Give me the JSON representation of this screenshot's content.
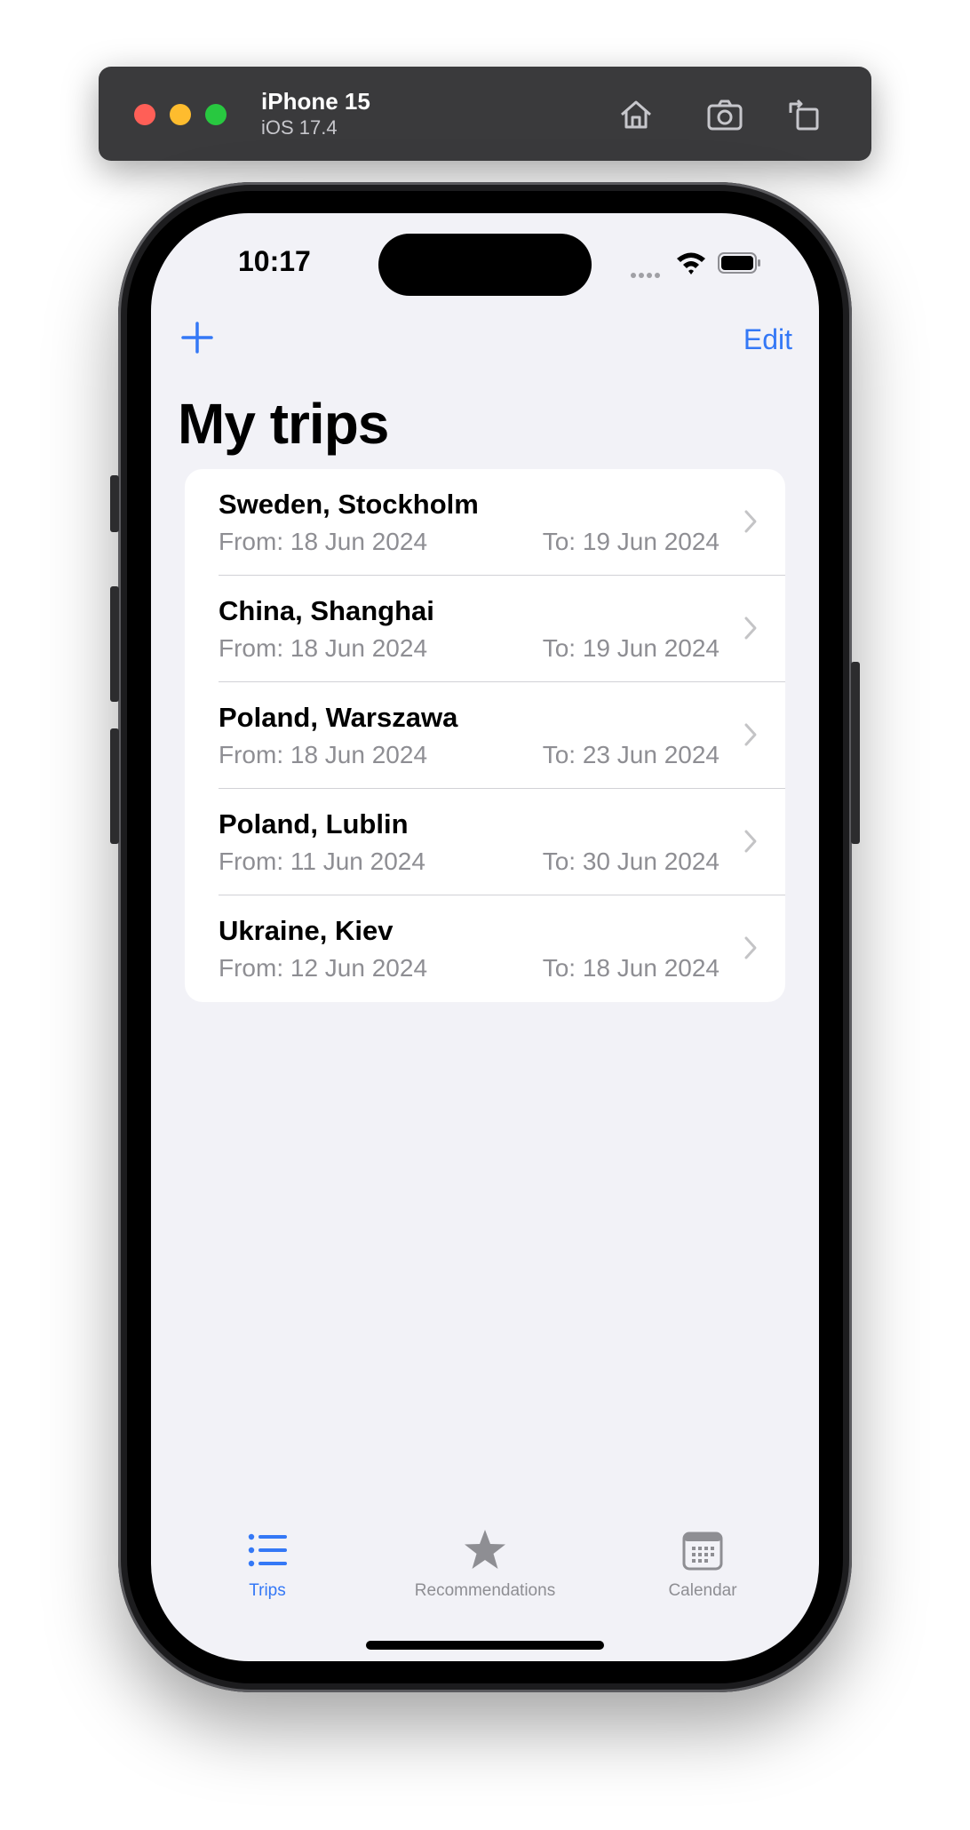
{
  "simulator": {
    "device": "iPhone 15",
    "os": "iOS 17.4",
    "icons": [
      "home-icon",
      "screenshot-icon",
      "rotate-icon"
    ]
  },
  "status_bar": {
    "time": "10:17"
  },
  "nav": {
    "edit_label": "Edit",
    "plus_icon": "plus-icon"
  },
  "page": {
    "title": "My trips"
  },
  "trips": [
    {
      "place": "Sweden, Stockholm",
      "from": "From: 18 Jun 2024",
      "to": "To: 19 Jun 2024"
    },
    {
      "place": "China, Shanghai",
      "from": "From: 18 Jun 2024",
      "to": "To: 19 Jun 2024"
    },
    {
      "place": "Poland, Warszawa",
      "from": "From: 18 Jun 2024",
      "to": "To: 23 Jun 2024"
    },
    {
      "place": "Poland, Lublin",
      "from": "From: 11 Jun 2024",
      "to": "To: 30 Jun 2024"
    },
    {
      "place": "Ukraine, Kiev",
      "from": "From: 12 Jun 2024",
      "to": "To: 18 Jun 2024"
    }
  ],
  "tabbar": {
    "tabs": [
      {
        "label": "Trips",
        "icon": "list-icon",
        "active": true
      },
      {
        "label": "Recommendations",
        "icon": "star-icon",
        "active": false
      },
      {
        "label": "Calendar",
        "icon": "calendar-icon",
        "active": false
      }
    ]
  },
  "colors": {
    "accent": "#3478f6",
    "secondary_text": "#8e8e93",
    "background": "#f2f2f7"
  }
}
